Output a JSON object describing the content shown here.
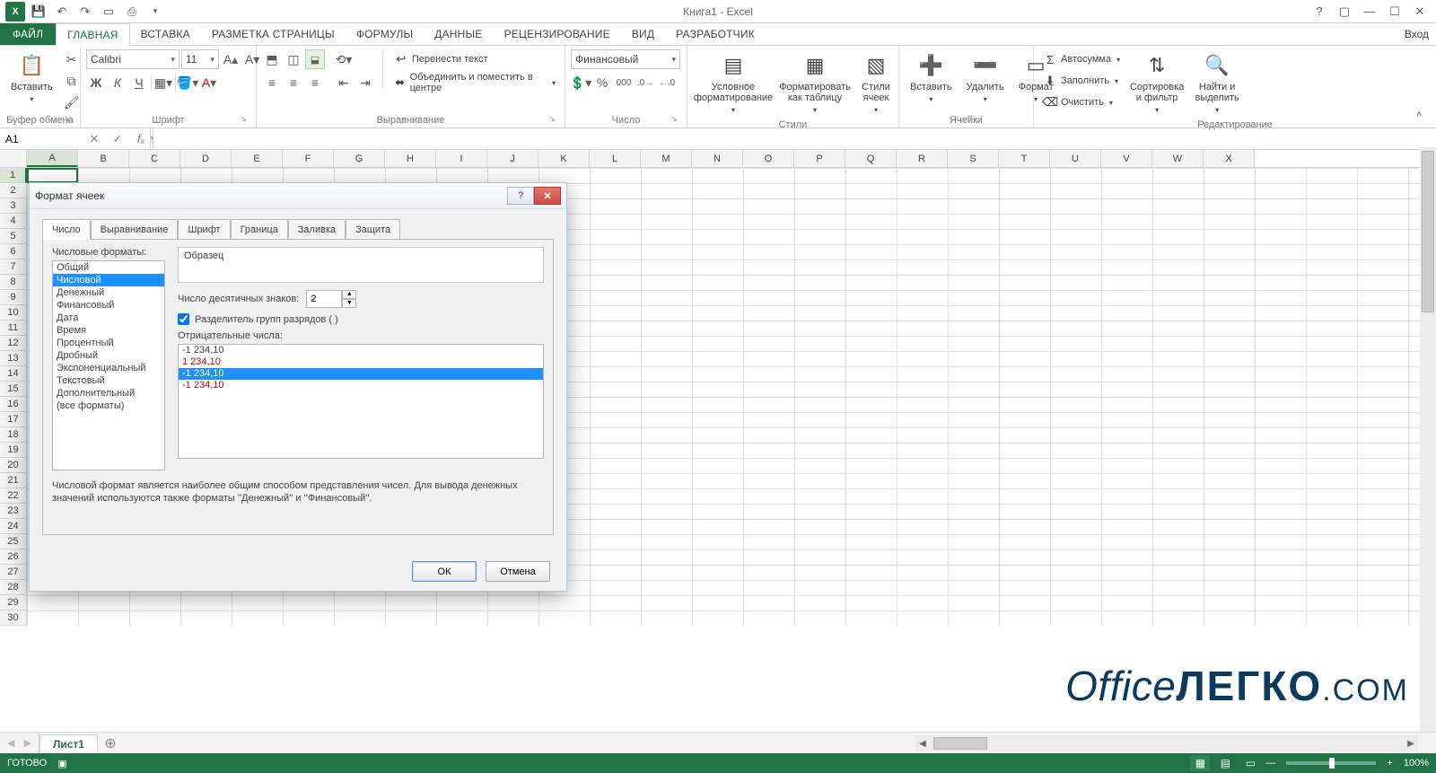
{
  "app": {
    "title": "Книга1 - Excel",
    "login": "Вход"
  },
  "qat": {
    "save": "💾",
    "undo": "↶",
    "redo": "↷",
    "touch": "👆",
    "print": "⎙"
  },
  "tabs": {
    "file": "ФАЙЛ",
    "home": "ГЛАВНАЯ",
    "insert": "ВСТАВКА",
    "layout": "РАЗМЕТКА СТРАНИЦЫ",
    "formulas": "ФОРМУЛЫ",
    "data": "ДАННЫЕ",
    "review": "РЕЦЕНЗИРОВАНИЕ",
    "view": "ВИД",
    "developer": "РАЗРАБОТЧИК"
  },
  "ribbon": {
    "clipboard": {
      "label": "Буфер обмена",
      "paste": "Вставить"
    },
    "font": {
      "label": "Шрифт",
      "family": "Calibri",
      "size": "11",
      "bold": "Ж",
      "italic": "К",
      "underline": "Ч"
    },
    "align": {
      "label": "Выравнивание",
      "wrap": "Перенести текст",
      "merge": "Объединить и поместить в центре"
    },
    "number": {
      "label": "Число",
      "format": "Финансовый",
      "percent": "%",
      "comma": "000"
    },
    "styles": {
      "label": "Стили",
      "conditional": "Условное форматирование",
      "table": "Форматировать как таблицу",
      "cell": "Стили ячеек"
    },
    "cells": {
      "label": "Ячейки",
      "insert": "Вставить",
      "delete": "Удалить",
      "format": "Формат"
    },
    "editing": {
      "label": "Редактирование",
      "autosum": "Автосумма",
      "fill": "Заполнить",
      "clear": "Очистить",
      "sort": "Сортировка и фильтр",
      "find": "Найти и выделить"
    }
  },
  "namebox": {
    "value": "A1"
  },
  "columns": [
    "A",
    "B",
    "C",
    "D",
    "E",
    "F",
    "G",
    "H",
    "I",
    "J",
    "K",
    "L",
    "M",
    "N",
    "O",
    "P",
    "Q",
    "R",
    "S",
    "T",
    "U",
    "V",
    "W",
    "X"
  ],
  "rows": [
    1,
    2,
    3,
    4,
    5,
    6,
    7,
    8,
    9,
    10,
    11,
    12,
    13,
    14,
    15,
    16,
    17,
    18,
    19,
    20,
    21,
    22,
    23,
    24,
    25,
    26,
    27,
    28,
    29,
    30
  ],
  "sheet": {
    "name": "Лист1"
  },
  "status": {
    "ready": "ГОТОВО",
    "zoom": "100%"
  },
  "dialog": {
    "title": "Формат ячеек",
    "tabs": [
      "Число",
      "Выравнивание",
      "Шрифт",
      "Граница",
      "Заливка",
      "Защита"
    ],
    "activeTab": 0,
    "numberFormatsLabel": "Числовые форматы:",
    "categories": [
      "Общий",
      "Числовой",
      "Денежный",
      "Финансовый",
      "Дата",
      "Время",
      "Процентный",
      "Дробный",
      "Экспоненциальный",
      "Текстовый",
      "Дополнительный",
      "(все форматы)"
    ],
    "selectedCategory": 1,
    "sampleLabel": "Образец",
    "decimalsLabel": "Число десятичных знаков:",
    "decimals": "2",
    "thousandsLabel": "Разделитель групп разрядов ( )",
    "thousandsChecked": true,
    "negativeLabel": "Отрицательные числа:",
    "negatives": [
      {
        "text": "-1 234,10",
        "red": false
      },
      {
        "text": "1 234,10",
        "red": true
      },
      {
        "text": "-1 234,10",
        "red": false
      },
      {
        "text": "-1 234,10",
        "red": true
      }
    ],
    "selectedNegative": 2,
    "description": "Числовой формат является наиболее общим способом представления чисел. Для вывода денежных значений используются также форматы ''Денежный'' и ''Финансовый''.",
    "ok": "ОК",
    "cancel": "Отмена"
  },
  "watermark": {
    "p1": "Office",
    "p2": "ЛЕГКО",
    "p3": ".COM"
  }
}
